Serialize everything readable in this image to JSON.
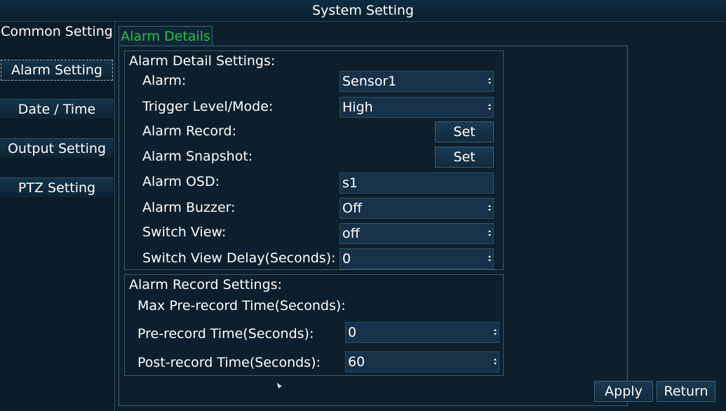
{
  "window": {
    "title": "System Setting"
  },
  "sidebar": {
    "items": [
      {
        "label": "Common Setting"
      },
      {
        "label": "Alarm Setting"
      },
      {
        "label": "Date / Time"
      },
      {
        "label": "Output Setting"
      },
      {
        "label": "PTZ Setting"
      }
    ]
  },
  "tab": {
    "label": "Alarm Details"
  },
  "details": {
    "title": "Alarm Detail Settings:",
    "alarm": {
      "label": "Alarm:",
      "value": "Sensor1"
    },
    "trigger": {
      "label": "Trigger Level/Mode:",
      "value": "High"
    },
    "record": {
      "label": "Alarm Record:",
      "button": "Set"
    },
    "snapshot": {
      "label": "Alarm Snapshot:",
      "button": "Set"
    },
    "osd": {
      "label": "Alarm OSD:",
      "value": "s1"
    },
    "buzzer": {
      "label": "Alarm Buzzer:",
      "value": "Off"
    },
    "switch_view": {
      "label": "Switch View:",
      "value": "off"
    },
    "switch_delay": {
      "label": "Switch View Delay(Seconds):",
      "value": "0"
    }
  },
  "record_settings": {
    "title": "Alarm Record Settings:",
    "max_pre": {
      "label": "Max Pre-record Time(Seconds):"
    },
    "pre": {
      "label": "Pre-record Time(Seconds):",
      "value": "0"
    },
    "post": {
      "label": "Post-record Time(Seconds):",
      "value": "60"
    }
  },
  "footer": {
    "apply": "Apply",
    "return": "Return"
  },
  "colors": {
    "tab_text": "#27c13f",
    "background": "#0d1f2c",
    "field": "#173148"
  }
}
